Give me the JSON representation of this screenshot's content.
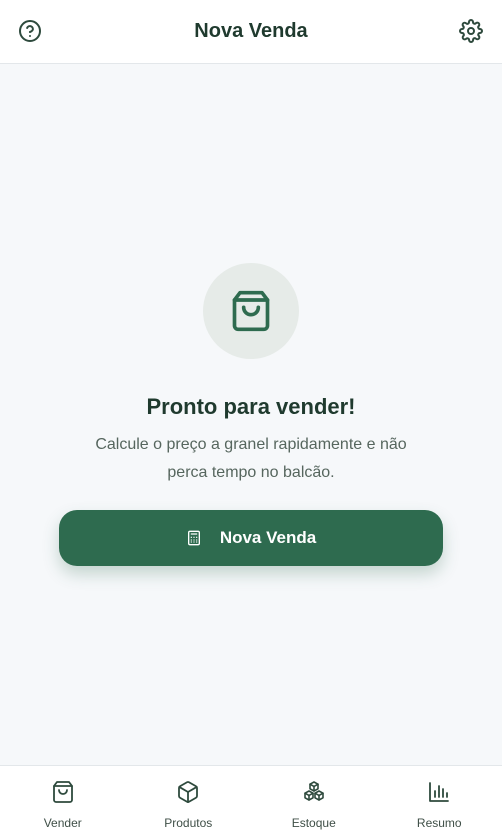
{
  "header": {
    "title": "Nova Venda",
    "help_icon": "help-circle-icon",
    "settings_icon": "gear-icon"
  },
  "hero": {
    "icon": "shopping-bag-icon",
    "title": "Pronto para vender!",
    "subtitle": "Calcule o preço a granel rapidamente e não perca tempo no balcão."
  },
  "cta": {
    "icon": "calculator-icon",
    "label": "Nova Venda"
  },
  "bottom_nav": {
    "items": [
      {
        "label": "Vender",
        "icon": "shopping-bag-icon"
      },
      {
        "label": "Produtos",
        "icon": "package-icon"
      },
      {
        "label": "Estoque",
        "icon": "boxes-icon"
      },
      {
        "label": "Resumo",
        "icon": "bar-chart-icon"
      }
    ]
  },
  "colors": {
    "primary": "#2e6b4f",
    "text_dark": "#1f3a2e",
    "text_muted": "#56665e",
    "background": "#f6f8fa",
    "hero_circle": "#e6ebe8"
  }
}
